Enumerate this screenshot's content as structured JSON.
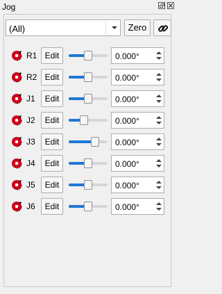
{
  "window": {
    "title": "Jog"
  },
  "toolbar": {
    "group_selected": "(All)",
    "zero_label": "Zero"
  },
  "joints": [
    {
      "label": "R1",
      "edit_label": "Edit",
      "value": "0.000°",
      "slider": 0.5
    },
    {
      "label": "R2",
      "edit_label": "Edit",
      "value": "0.000°",
      "slider": 0.5
    },
    {
      "label": "J1",
      "edit_label": "Edit",
      "value": "0.000°",
      "slider": 0.5
    },
    {
      "label": "J2",
      "edit_label": "Edit",
      "value": "0.000°",
      "slider": 0.4
    },
    {
      "label": "J3",
      "edit_label": "Edit",
      "value": "0.000°",
      "slider": 0.67
    },
    {
      "label": "J4",
      "edit_label": "Edit",
      "value": "0.000°",
      "slider": 0.5
    },
    {
      "label": "J5",
      "edit_label": "Edit",
      "value": "0.000°",
      "slider": 0.5
    },
    {
      "label": "J6",
      "edit_label": "Edit",
      "value": "0.000°",
      "slider": 0.5
    }
  ],
  "colors": {
    "accent": "#1e78d7",
    "joint_icon": "#d0021b"
  },
  "icons": {
    "joint": "revolute-joint-icon",
    "link": "link-icon",
    "float": "float-window-icon",
    "close": "close-icon"
  }
}
